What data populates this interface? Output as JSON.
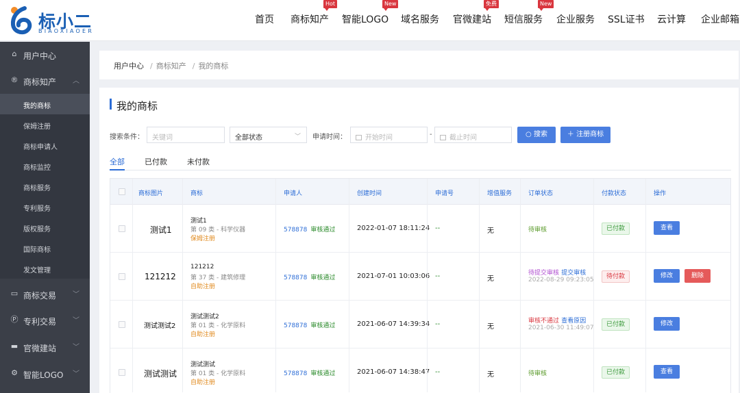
{
  "logo": {
    "text": "标小二",
    "sub": "BIAOXIAOER"
  },
  "nav": {
    "items": [
      {
        "label": "首页",
        "badge": ""
      },
      {
        "label": "商标知产",
        "badge": "Hot"
      },
      {
        "label": "智能LOGO",
        "badge": "New"
      },
      {
        "label": "域名服务",
        "badge": ""
      },
      {
        "label": "官微建站",
        "badge": "免费"
      },
      {
        "label": "短信服务",
        "badge": "New"
      },
      {
        "label": "企业服务",
        "badge": ""
      },
      {
        "label": "SSL证书",
        "badge": ""
      },
      {
        "label": "云计算",
        "badge": ""
      },
      {
        "label": "企业邮箱",
        "badge": ""
      }
    ]
  },
  "sidebar": {
    "groups": [
      {
        "label": "用户中心",
        "icon": "home-icon"
      },
      {
        "label": "商标知产",
        "icon": "registered-icon"
      },
      {
        "label": "商标交易",
        "icon": "cart-icon"
      },
      {
        "label": "专利交易",
        "icon": "patent-icon"
      },
      {
        "label": "官微建站",
        "icon": "monitor-icon"
      },
      {
        "label": "智能LOGO",
        "icon": "gear-icon"
      }
    ],
    "subitems": [
      "我的商标",
      "保姆注册",
      "商标申请人",
      "商标监控",
      "商标服务",
      "专利服务",
      "版权服务",
      "国际商标",
      "发文管理"
    ]
  },
  "breadcrumb": {
    "items": [
      "用户中心",
      "商标知产",
      "我的商标"
    ],
    "separator": "/"
  },
  "page": {
    "title": "我的商标"
  },
  "filter": {
    "label": "搜索条件：",
    "keyword_placeholder": "关键词",
    "status_value": "全部状态",
    "date_label": "申请时间：",
    "start_placeholder": "开始时间",
    "end_placeholder": "截止时间",
    "dash": "-",
    "search_label": "搜索",
    "register_label": "注册商标"
  },
  "tabs": [
    "全部",
    "已付款",
    "未付款"
  ],
  "table": {
    "headers": [
      "商标图片",
      "商标",
      "申请人",
      "创建时间",
      "申请号",
      "增值服务",
      "订单状态",
      "付款状态",
      "操作"
    ],
    "rows": [
      {
        "image_text": "测试1",
        "tm_name": "测试1",
        "tm_class": "第 09 类 - 科学仪器",
        "tm_type": "保姆注册",
        "applicant_id": "578878",
        "applicant_status": "审核通过",
        "created": "2022-01-07 18:11:24",
        "app_no": "--",
        "vas": "无",
        "order_status": [
          {
            "text": "待审核",
            "style": "pending"
          }
        ],
        "order_time": "",
        "pay_status": "已付款",
        "pay_style": "paid",
        "ops": [
          {
            "label": "查看",
            "style": "blue"
          }
        ]
      },
      {
        "image_text": "121212",
        "tm_name": "121212",
        "tm_class": "第 37 类 - 建筑修理",
        "tm_type": "自助注册",
        "applicant_id": "578878",
        "applicant_status": "审核通过",
        "created": "2021-07-01 10:03:06",
        "app_no": "--",
        "vas": "无",
        "order_status": [
          {
            "text": "待提交审核",
            "style": "purple"
          },
          {
            "text": "提交审核",
            "style": "blue"
          }
        ],
        "order_time": "2022-08-29 09:23:05",
        "pay_status": "待付款",
        "pay_style": "unpaid",
        "ops": [
          {
            "label": "修改",
            "style": "blue"
          },
          {
            "label": "删除",
            "style": "red"
          }
        ]
      },
      {
        "image_text": "测试测试2",
        "tm_name": "测试测试2",
        "tm_class": "第 01 类 - 化学原料",
        "tm_type": "自助注册",
        "applicant_id": "578878",
        "applicant_status": "审核通过",
        "created": "2021-06-07 14:39:34",
        "app_no": "--",
        "vas": "无",
        "order_status": [
          {
            "text": "审核不通过",
            "style": "red"
          },
          {
            "text": "查看原因",
            "style": "blue"
          }
        ],
        "order_time": "2021-06-30 11:49:07",
        "pay_status": "已付款",
        "pay_style": "paid",
        "ops": [
          {
            "label": "修改",
            "style": "blue"
          }
        ]
      },
      {
        "image_text": "测试测试",
        "tm_name": "测试测试",
        "tm_class": "第 01 类 - 化学原料",
        "tm_type": "自助注册",
        "applicant_id": "578878",
        "applicant_status": "审核通过",
        "created": "2021-06-07 14:38:47",
        "app_no": "--",
        "vas": "无",
        "order_status": [
          {
            "text": "待审核",
            "style": "pending"
          }
        ],
        "order_time": "",
        "pay_status": "已付款",
        "pay_style": "paid",
        "ops": [
          {
            "label": "查看",
            "style": "blue"
          }
        ]
      }
    ]
  },
  "colors": {
    "accent": "#2b6cd6",
    "sidebar_bg": "#3b3f48",
    "danger": "#e55a5a",
    "badge": "#d9363e"
  }
}
